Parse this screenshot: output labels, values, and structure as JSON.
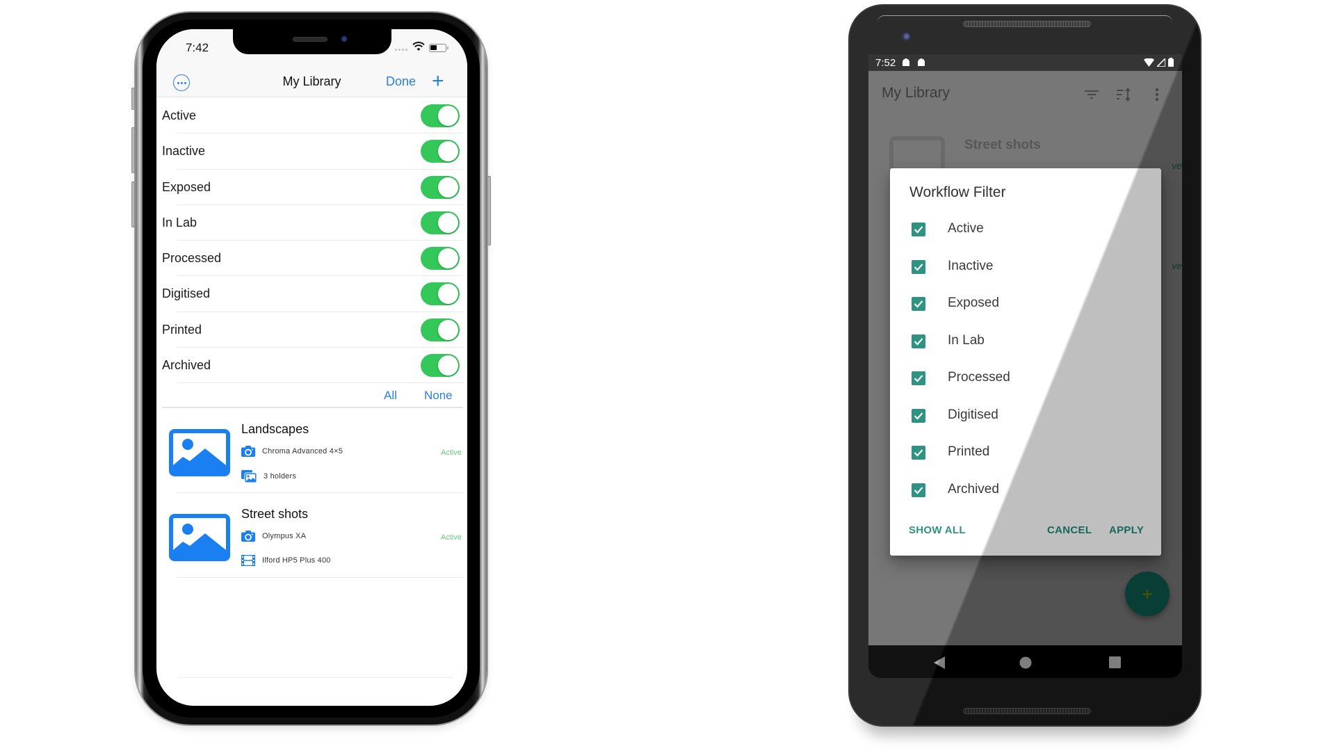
{
  "ios": {
    "status_time": "7:42",
    "nav_title": "My Library",
    "done_label": "Done",
    "more_icon": "ellipsis-circle-icon",
    "add_icon": "plus-icon",
    "filters": [
      {
        "label": "Active",
        "on": true
      },
      {
        "label": "Inactive",
        "on": true
      },
      {
        "label": "Exposed",
        "on": true
      },
      {
        "label": "In Lab",
        "on": true
      },
      {
        "label": "Processed",
        "on": true
      },
      {
        "label": "Digitised",
        "on": true
      },
      {
        "label": "Printed",
        "on": true
      },
      {
        "label": "Archived",
        "on": true
      }
    ],
    "all_label": "All",
    "none_label": "None",
    "projects": [
      {
        "name": "Landscapes",
        "camera": "Chroma Advanced 4×5",
        "second": "3 holders",
        "second_icon": "holders-icon",
        "status": "Active"
      },
      {
        "name": "Street shots",
        "camera": "Olympus XA",
        "second": "Ilford HP5 Plus 400",
        "second_icon": "film-icon",
        "status": "Active"
      }
    ],
    "colors": {
      "accent": "#2a7de1",
      "toggle_on": "#34c759",
      "status_active": "#6cc67b",
      "thumb": "#1a7ff0"
    }
  },
  "android": {
    "status_time": "7:52",
    "app_title": "My Library",
    "toolbar_icons": [
      "filter-icon",
      "sort-icon",
      "overflow-menu-icon"
    ],
    "background_item": {
      "name": "Street shots",
      "status_fragment": "ve"
    },
    "dialog": {
      "title": "Workflow Filter",
      "options": [
        {
          "label": "Active",
          "checked": true
        },
        {
          "label": "Inactive",
          "checked": true
        },
        {
          "label": "Exposed",
          "checked": true
        },
        {
          "label": "In Lab",
          "checked": true
        },
        {
          "label": "Processed",
          "checked": true
        },
        {
          "label": "Digitised",
          "checked": true
        },
        {
          "label": "Printed",
          "checked": true
        },
        {
          "label": "Archived",
          "checked": true
        }
      ],
      "show_all_label": "SHOW ALL",
      "cancel_label": "CANCEL",
      "apply_label": "APPLY"
    },
    "fab_icon": "plus-icon",
    "colors": {
      "accent": "#1e8b78",
      "fab": "#0b5348",
      "scrim_bg": "#6d6d6d"
    }
  }
}
